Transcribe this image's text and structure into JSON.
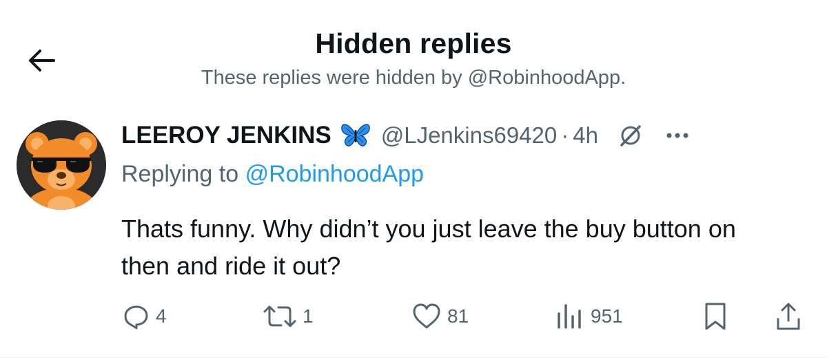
{
  "header": {
    "title": "Hidden replies",
    "subtitle": "These replies were hidden by @RobinhoodApp."
  },
  "tweet": {
    "display_name": "LEEROY JENKINS",
    "verified_emoji": "butterfly-icon",
    "handle": "@LJenkins69420",
    "separator": "·",
    "time": "4h",
    "replying_prefix": "Replying to",
    "replying_to": "@RobinhoodApp",
    "text": "Thats funny. Why didn’t you just leave the buy button on then and ride it out?"
  },
  "actions": {
    "replies": "4",
    "reposts": "1",
    "likes": "81",
    "views": "951"
  },
  "colors": {
    "text_primary": "#0f1419",
    "text_secondary": "#536471",
    "link": "#1d9bf0",
    "avatar_orange": "#f28c28"
  }
}
